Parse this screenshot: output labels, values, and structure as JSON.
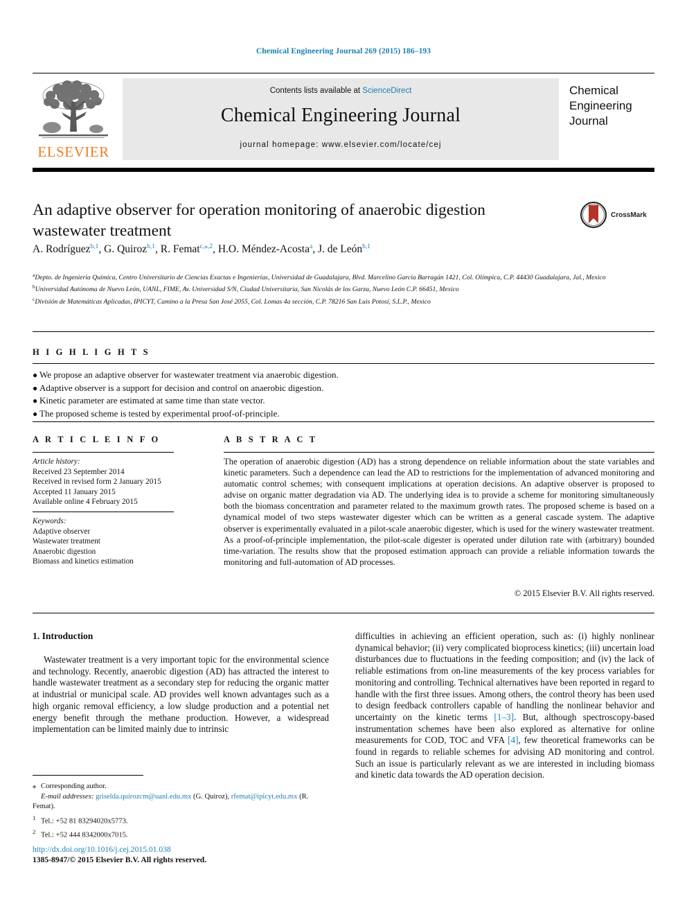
{
  "running_head": "Chemical Engineering Journal 269 (2015) 186–193",
  "masthead": {
    "contents_prefix": "Contents lists available at ",
    "sciencedirect": "ScienceDirect",
    "journal_title": "Chemical Engineering Journal",
    "homepage": "journal homepage: www.elsevier.com/locate/cej",
    "publisher": "ELSEVIER",
    "right_title_lines": [
      "Chemical",
      "Engineering",
      "Journal"
    ]
  },
  "article": {
    "title": "An adaptive observer for operation monitoring of anaerobic digestion wastewater treatment",
    "crossmark_label": "CrossMark",
    "authors": [
      {
        "name": "A. Rodríguez",
        "marks": "b,1"
      },
      {
        "name": "G. Quiroz",
        "marks": "b,1"
      },
      {
        "name": "R. Femat",
        "marks": "c,⁎,2"
      },
      {
        "name": "H.O. Méndez-Acosta",
        "marks": "a"
      },
      {
        "name": "J. de León",
        "marks": "b,1"
      }
    ],
    "affiliations": [
      {
        "mark": "a",
        "text": "Depto. de Ingeniería Química, Centro Universitario de Ciencias Exactas e Ingenierías, Universidad de Guadalajara, Blvd. Marcelino García Barragán 1421, Col. Olímpica, C.P. 44430 Guadalajara, Jal., Mexico"
      },
      {
        "mark": "b",
        "text": "Universidad Autónoma de Nuevo León, UANL, FIME, Av. Universidad S/N, Ciudad Universitaria, San Nicolás de los Garza, Nuevo León C.P. 66451, Mexico"
      },
      {
        "mark": "c",
        "text": "División de Matemáticas Aplicadas, IPICYT, Camino a la Presa San José 2055, Col. Lomas 4a sección, C.P. 78216 San Luis Potosí, S.L.P., Mexico"
      }
    ]
  },
  "highlights": {
    "heading": "H I G H L I G H T S",
    "items": [
      "We propose an adaptive observer for wastewater treatment via anaerobic digestion.",
      "Adaptive observer is a support for decision and control on anaerobic digestion.",
      "Kinetic parameter are estimated at same time than state vector.",
      "The proposed scheme is tested by experimental proof-of-principle."
    ]
  },
  "article_info": {
    "heading": "A R T I C L E    I N F O",
    "history_label": "Article history:",
    "history": [
      "Received 23 September 2014",
      "Received in revised form 2 January 2015",
      "Accepted 11 January 2015",
      "Available online 4 February 2015"
    ],
    "keywords_label": "Keywords:",
    "keywords": [
      "Adaptive observer",
      "Wastewater treatment",
      "Anaerobic digestion",
      "Biomass and kinetics estimation"
    ]
  },
  "abstract": {
    "heading": "A B S T R A C T",
    "text": "The operation of anaerobic digestion (AD) has a strong dependence on reliable information about the state variables and kinetic parameters. Such a dependence can lead the AD to restrictions for the implementation of advanced monitoring and automatic control schemes; with consequent implications at operation decisions. An adaptive observer is proposed to advise on organic matter degradation via AD. The underlying idea is to provide a scheme for monitoring simultaneously both the biomass concentration and parameter related to the maximum growth rates. The proposed scheme is based on a dynamical model of two steps wastewater digester which can be written as a general cascade system. The adaptive observer is experimentally evaluated in a pilot-scale anaerobic digester, which is used for the winery wastewater treatment. As a proof-of-principle implementation, the pilot-scale digester is operated under dilution rate with (arbitrary) bounded time-variation. The results show that the proposed estimation approach can provide a reliable information towards the monitoring and full-automation of AD processes.",
    "copyright": "© 2015 Elsevier B.V. All rights reserved."
  },
  "body": {
    "section_number_title": "1. Introduction",
    "left_paragraph": "Wastewater treatment is a very important topic for the environmental science and technology. Recently, anaerobic digestion (AD) has attracted the interest to handle wastewater treatment as a secondary step for reducing the organic matter at industrial or municipal scale. AD provides well known advantages such as a high organic removal efficiency, a low sludge production and a potential net energy benefit through the methane production. However, a widespread implementation can be limited mainly due to intrinsic",
    "right_part_1": "difficulties in achieving an efficient operation, such as: (i) highly nonlinear dynamical behavior; (ii) very complicated bioprocess kinetics; (iii) uncertain load disturbances due to fluctuations in the feeding composition; and (iv) the lack of reliable estimations from on-line measurements of the key process variables for monitoring and controlling. Technical alternatives have been reported in regard to handle with the first three issues. Among others, the control theory has been used to design feedback controllers capable of handling the nonlinear behavior and uncertainty on the kinetic terms ",
    "ref_1": "[1–3]",
    "right_part_2": ". But, although spectroscopy-based instrumentation schemes have been also explored as alternative for online measurements for COD, TOC and VFA ",
    "ref_2": "[4]",
    "right_part_3": ", few theoretical frameworks can be found in regards to reliable schemes for advising AD monitoring and control. Such an issue is particularly relevant as we are interested in including biomass and kinetic data towards the AD operation decision."
  },
  "footnotes": {
    "corresponding": "Corresponding author.",
    "email_label": "E-mail addresses:",
    "email_1": "griselda.quirozcm@uanl.edu.mx",
    "email_1_owner": "(G. Quiroz),",
    "email_2": "rfemat@ipicyt.edu.mx",
    "email_2_owner": "(R. Femat).",
    "tel_1_mark": "1",
    "tel_1": "Tel.: +52 81 83294020x5773.",
    "tel_2_mark": "2",
    "tel_2": "Tel.: +52 444 8342000x7015.",
    "doi": "http://dx.doi.org/10.1016/j.cej.2015.01.038",
    "issn": "1385-8947/© 2015 Elsevier B.V. All rights reserved."
  },
  "colors": {
    "link": "#1a7eb5",
    "elsevier_orange": "#ef7d22",
    "masthead_gray": "#e8e8e8",
    "crossmark_red": "#b5342a"
  }
}
